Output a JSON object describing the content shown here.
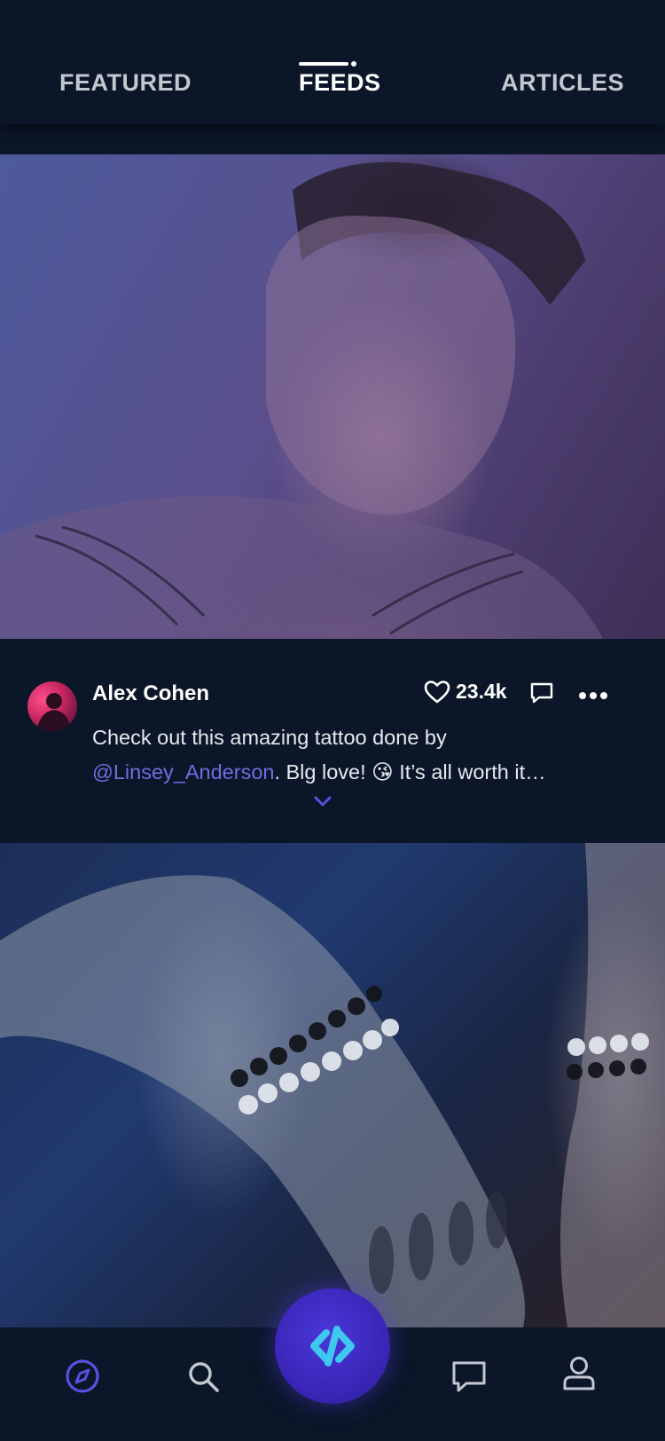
{
  "tabs": [
    {
      "label": "FEATURED",
      "active": false
    },
    {
      "label": "FEEDS",
      "active": true
    },
    {
      "label": "ARTICLES",
      "active": false
    }
  ],
  "post": {
    "author": "Alex Cohen",
    "likes": "23.4k",
    "caption_before": "Check out this amazing tattoo done by ",
    "mention": "@Linsey_Anderson",
    "caption_after": ". Blg love! 😘 It’s all worth it…"
  },
  "bottom_nav": {
    "items": [
      "compass-icon",
      "search-icon",
      "code-icon",
      "chat-icon",
      "profile-icon"
    ],
    "active": "compass-icon"
  },
  "colors": {
    "background": "#0b1628",
    "accent": "#5b4fe0",
    "mention": "#6f6ee0"
  }
}
